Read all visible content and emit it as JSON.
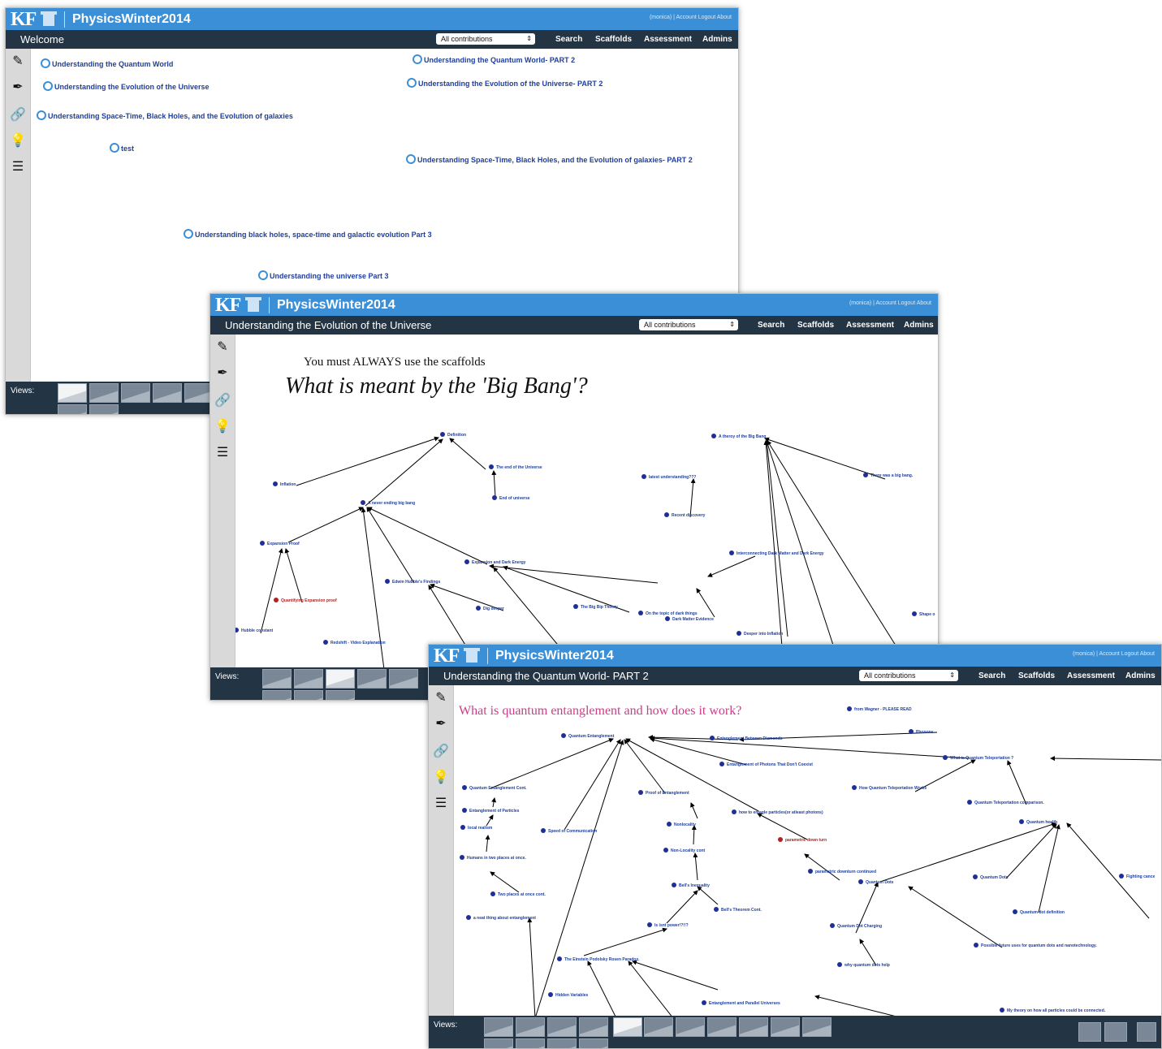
{
  "app": {
    "logo": "KF",
    "community": "PhysicsWinter2014",
    "account_links": "(monica) | Account  Logout  About"
  },
  "menu": {
    "filter": "All contributions",
    "search": "Search",
    "scaffolds": "Scaffolds",
    "assessment": "Assessment",
    "admins": "Admins"
  },
  "views_label": "Views:",
  "tools": [
    "pencil-icon",
    "brush-icon",
    "link-icon",
    "lightbulb-icon",
    "list-icon"
  ],
  "window1": {
    "title": "Welcome",
    "links": [
      {
        "label": "Understanding the Quantum World"
      },
      {
        "label": "Understanding the Quantum World- PART 2"
      },
      {
        "label": "Understanding the Evolution of the Universe"
      },
      {
        "label": "Understanding the Evolution of the Universe- PART 2"
      },
      {
        "label": "Understanding Space-Time, Black Holes, and the Evolution of galaxies"
      },
      {
        "label": "test"
      },
      {
        "label": "Understanding Space-Time, Black Holes, and the Evolution of galaxies- PART 2"
      },
      {
        "label": "Understanding black holes, space-time and galactic evolution Part 3"
      },
      {
        "label": "Understanding the universe Part 3"
      }
    ]
  },
  "window2": {
    "title": "Understanding the Evolution of the Universe",
    "scaffold_note": "You must ALWAYS use the scaffolds",
    "question": "What is meant by the 'Big Bang'?",
    "notes": [
      {
        "label": "Definition"
      },
      {
        "label": "The end of the Universe"
      },
      {
        "label": "End of universe"
      },
      {
        "label": "Inflation"
      },
      {
        "label": "A never ending big bang"
      },
      {
        "label": "Expansion Proof"
      },
      {
        "label": "Quantifying Expansion proof",
        "color": "#b22222"
      },
      {
        "label": "Hubble constant"
      },
      {
        "label": "Edwin Hubble's Findings"
      },
      {
        "label": "Dig deeper"
      },
      {
        "label": "Expansion and Dark Energy"
      },
      {
        "label": "The Big Bip Theory"
      },
      {
        "label": "Redshift - Video Explanation"
      },
      {
        "label": "A theroy of the Big Bang"
      },
      {
        "label": "latest understanding???"
      },
      {
        "label": "There was a big bang."
      },
      {
        "label": "Recent discovery"
      },
      {
        "label": "Interconnecting Dark Matter and Dark Energy"
      },
      {
        "label": "On the topic of dark things"
      },
      {
        "label": "Dark Matter Evidence"
      },
      {
        "label": "Deeper into Inflation"
      },
      {
        "label": "Shape o"
      }
    ]
  },
  "window3": {
    "title": "Understanding the Quantum World- PART 2",
    "question": "What is quantum entanglement and how does it work?",
    "notes": [
      {
        "label": "from Wagner - PLEASE READ"
      },
      {
        "label": "Quantum Entanglement"
      },
      {
        "label": "Entanglement Between Diamonds"
      },
      {
        "label": "Phonons"
      },
      {
        "label": "Entanglement of Photons That Don't Coexist"
      },
      {
        "label": "What is Quantum Teleportation ?"
      },
      {
        "label": "Quantum Entanglement Cont."
      },
      {
        "label": "Proof of Entanglement"
      },
      {
        "label": "How Quantum Teleportation Works"
      },
      {
        "label": "Entanglement of Particles"
      },
      {
        "label": "Quantum Teleportation comparison."
      },
      {
        "label": "Speed of Communication"
      },
      {
        "label": "Nonlocality"
      },
      {
        "label": "how to entagle particles(or atleast photons)"
      },
      {
        "label": "local realism"
      },
      {
        "label": "parametric down turn",
        "color": "#b22222"
      },
      {
        "label": "Quantum health"
      },
      {
        "label": "Non-Locality cont"
      },
      {
        "label": "Humans in two places at once."
      },
      {
        "label": "parametric downturn continued"
      },
      {
        "label": "Quantum Dots"
      },
      {
        "label": "Quantum Dots"
      },
      {
        "label": "Fighting cance"
      },
      {
        "label": "Bell's Inequality"
      },
      {
        "label": "Two places at once cont."
      },
      {
        "label": "Bell's Theorem Cont."
      },
      {
        "label": "Quantum dot definition"
      },
      {
        "label": "a neat thing about entanglement"
      },
      {
        "label": "Is isnt power!?!!?"
      },
      {
        "label": "Quantum Dot Charging"
      },
      {
        "label": "Possible future uses for quantum dots and nanotechnology."
      },
      {
        "label": "The Einstein Podolsky Rosen Paradox."
      },
      {
        "label": "why quantum dots help"
      },
      {
        "label": "Hidden Variables"
      },
      {
        "label": "Entanglement and Parallel Universes"
      },
      {
        "label": "My theory on how all particles could be connected."
      }
    ]
  }
}
